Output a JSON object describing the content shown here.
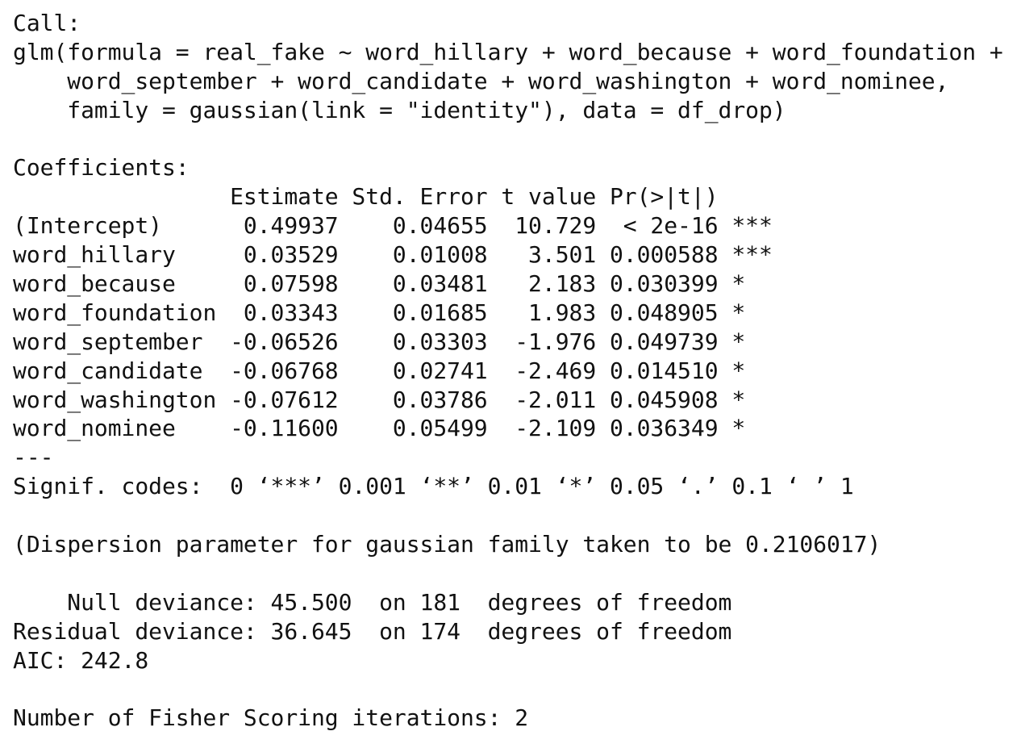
{
  "output": {
    "lines": [
      "Call:",
      "glm(formula = real_fake ~ word_hillary + word_because + word_foundation +",
      "    word_september + word_candidate + word_washington + word_nominee,",
      "    family = gaussian(link = \"identity\"), data = df_drop)",
      "",
      "Coefficients:",
      "                Estimate Std. Error t value Pr(>|t|)    ",
      "(Intercept)      0.49937    0.04655  10.729  < 2e-16 ***",
      "word_hillary     0.03529    0.01008   3.501 0.000588 ***",
      "word_because     0.07598    0.03481   2.183 0.030399 *  ",
      "word_foundation  0.03343    0.01685   1.983 0.048905 *  ",
      "word_september  -0.06526    0.03303  -1.976 0.049739 *  ",
      "word_candidate  -0.06768    0.02741  -2.469 0.014510 *  ",
      "word_washington -0.07612    0.03786  -2.011 0.045908 *  ",
      "word_nominee    -0.11600    0.05499  -2.109 0.036349 *  ",
      "---",
      "Signif. codes:  0 ‘***’ 0.001 ‘**’ 0.01 ‘*’ 0.05 ‘.’ 0.1 ‘ ’ 1",
      "",
      "(Dispersion parameter for gaussian family taken to be 0.2106017)",
      "",
      "    Null deviance: 45.500  on 181  degrees of freedom",
      "Residual deviance: 36.645  on 174  degrees of freedom",
      "AIC: 242.8",
      "",
      "Number of Fisher Scoring iterations: 2"
    ]
  }
}
